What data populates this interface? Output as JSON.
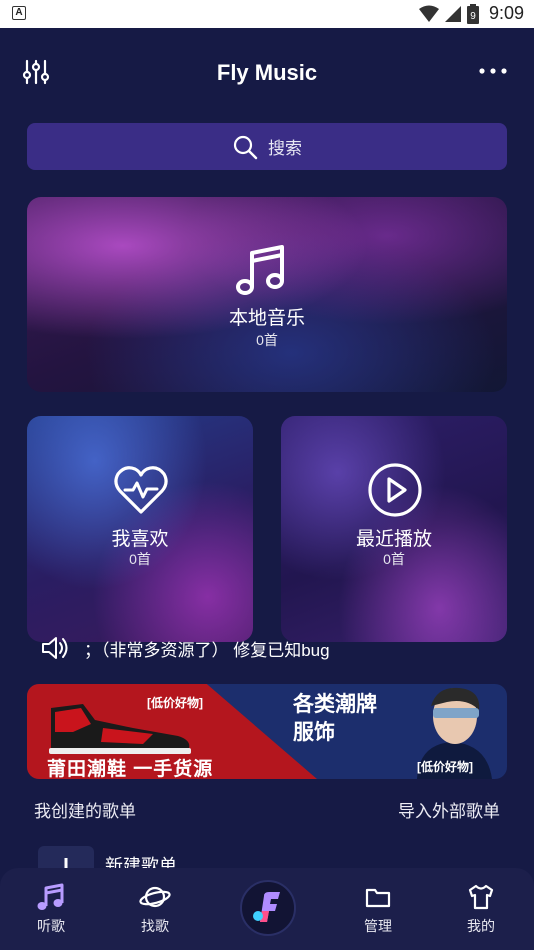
{
  "status_bar": {
    "time": "9:09",
    "battery_level": "9"
  },
  "header": {
    "title": "Fly Music"
  },
  "search": {
    "placeholder": "搜索"
  },
  "cards": {
    "local": {
      "label": "本地音乐",
      "count": "0首"
    },
    "favorites": {
      "label": "我喜欢",
      "count": "0首"
    },
    "recent": {
      "label": "最近播放",
      "count": "0首"
    }
  },
  "notice": {
    "text": "；（非常多资源了） 修复已知bug"
  },
  "banner": {
    "tag_left": "[低价好物]",
    "slogan_left": "莆田潮鞋  一手货源",
    "slogan_right_line1": "各类潮牌",
    "slogan_right_line2": "服饰",
    "tag_right": "[低价好物]"
  },
  "playlists": {
    "my_created": "我创建的歌单",
    "import_external": "导入外部歌单",
    "new_playlist": "新建歌单"
  },
  "bottom_nav": {
    "items": [
      {
        "label": "听歌",
        "icon": "music-note-icon",
        "active": true
      },
      {
        "label": "找歌",
        "icon": "planet-icon"
      },
      {
        "label": "",
        "icon": "app-logo-icon"
      },
      {
        "label": "管理",
        "icon": "folder-icon"
      },
      {
        "label": "我的",
        "icon": "tshirt-icon"
      }
    ]
  },
  "colors": {
    "background": "#161a45",
    "search_bg": "#3a2d86",
    "accent": "#9b6cff",
    "banner_red": "#b4161e"
  }
}
